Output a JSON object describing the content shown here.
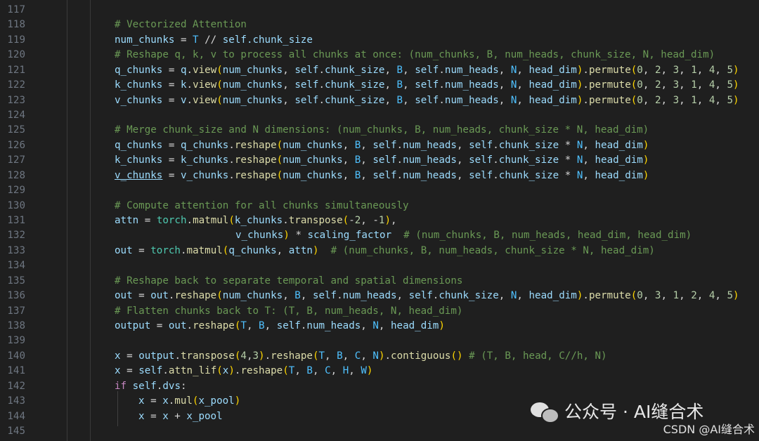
{
  "editor": {
    "lines": [
      {
        "no": "117"
      },
      {
        "no": "118"
      },
      {
        "no": "119"
      },
      {
        "no": "120"
      },
      {
        "no": "121"
      },
      {
        "no": "122"
      },
      {
        "no": "123"
      },
      {
        "no": "124"
      },
      {
        "no": "125"
      },
      {
        "no": "126"
      },
      {
        "no": "127"
      },
      {
        "no": "128"
      },
      {
        "no": "129"
      },
      {
        "no": "130"
      },
      {
        "no": "131"
      },
      {
        "no": "132"
      },
      {
        "no": "133"
      },
      {
        "no": "134"
      },
      {
        "no": "135"
      },
      {
        "no": "136"
      },
      {
        "no": "137"
      },
      {
        "no": "138"
      },
      {
        "no": "139"
      },
      {
        "no": "140"
      },
      {
        "no": "141"
      },
      {
        "no": "142"
      },
      {
        "no": "143"
      },
      {
        "no": "144"
      },
      {
        "no": "145"
      }
    ]
  },
  "code": {
    "l118": "# Vectorized Attention",
    "l119_var": "num_chunks",
    "l119_eq": " = ",
    "l119_T": "T",
    "l119_op": " // ",
    "l119_self": "self",
    "l119_attr": ".chunk_size",
    "l120": "# Reshape q, k, v to process all chunks at once: (num_chunks, B, num_heads, chunk_size, N, head_dim)",
    "l121": "q_chunks = q.view(num_chunks, self.chunk_size, B, self.num_heads, N, head_dim).permute(0, 2, 3, 1, 4, 5)",
    "l122": "k_chunks = k.view(num_chunks, self.chunk_size, B, self.num_heads, N, head_dim).permute(0, 2, 3, 1, 4, 5)",
    "l123": "v_chunks = v.view(num_chunks, self.chunk_size, B, self.num_heads, N, head_dim).permute(0, 2, 3, 1, 4, 5)",
    "l125": "# Merge chunk_size and N dimensions: (num_chunks, B, num_heads, chunk_size * N, head_dim)",
    "l126": "q_chunks = q_chunks.reshape(num_chunks, B, self.num_heads, self.chunk_size * N, head_dim)",
    "l127": "k_chunks = k_chunks.reshape(num_chunks, B, self.num_heads, self.chunk_size * N, head_dim)",
    "l128": "v_chunks = v_chunks.reshape(num_chunks, B, self.num_heads, self.chunk_size * N, head_dim)",
    "l130": "# Compute attention for all chunks simultaneously",
    "l131": "attn = torch.matmul(k_chunks.transpose(-2, -1),",
    "l132": "v_chunks) * scaling_factor  # (num_chunks, B, num_heads, head_dim, head_dim)",
    "l133": "out = torch.matmul(q_chunks, attn)  # (num_chunks, B, num_heads, chunk_size * N, head_dim)",
    "l135": "# Reshape back to separate temporal and spatial dimensions",
    "l136": "out = out.reshape(num_chunks, B, self.num_heads, self.chunk_size, N, head_dim).permute(0, 3, 1, 2, 4, 5)",
    "l137": "# Flatten chunks back to T: (T, B, num_heads, N, head_dim)",
    "l138": "output = out.reshape(T, B, self.num_heads, N, head_dim)",
    "l140": "x = output.transpose(4,3).reshape(T, B, C, N).contiguous() # (T, B, head, C//h, N)",
    "l141": "x = self.attn_lif(x).reshape(T, B, C, H, W)",
    "l142": "if self.dvs:",
    "l143": "x = x.mul(x_pool)",
    "l144": "x = x + x_pool"
  },
  "watermark": {
    "text": "公众号 · AI缝合术",
    "credit": "CSDN @AI缝合术"
  },
  "colors": {
    "background": "#1f1f1f",
    "comment": "#6a9955",
    "variable": "#9cdcfe",
    "function": "#dcdcaa",
    "number": "#b5cea8",
    "keyword": "#c586c0"
  }
}
